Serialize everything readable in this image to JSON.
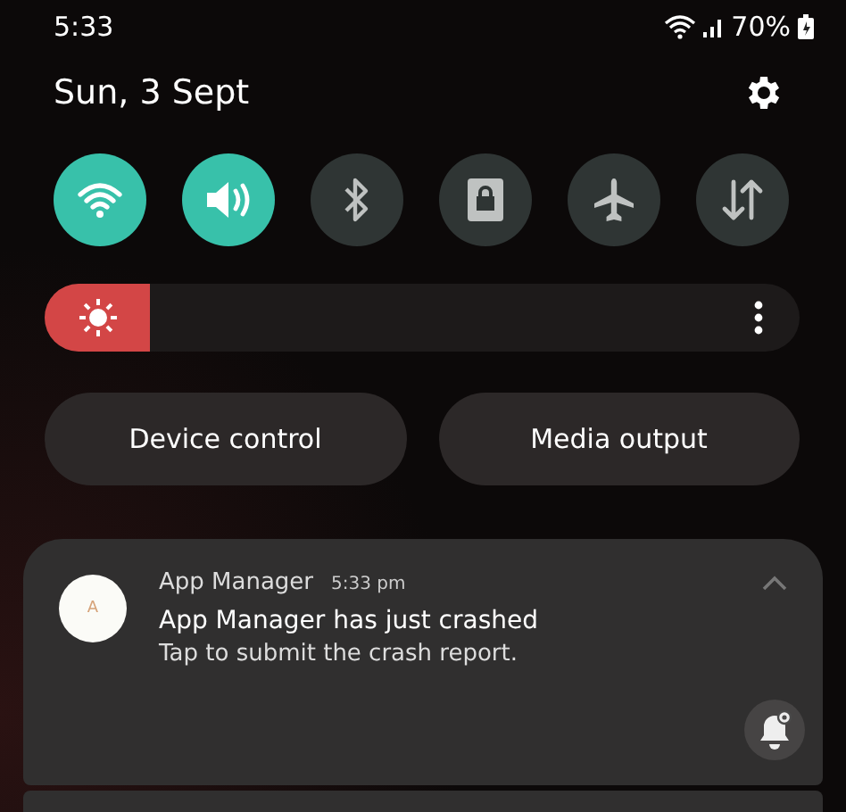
{
  "status_bar": {
    "time": "5:33",
    "battery": "70%"
  },
  "header": {
    "date": "Sun, 3 Sept"
  },
  "quick_tiles": [
    {
      "kind": "wifi",
      "on": true
    },
    {
      "kind": "sound",
      "on": true
    },
    {
      "kind": "bluetooth",
      "on": false
    },
    {
      "kind": "lock",
      "on": false
    },
    {
      "kind": "airplane",
      "on": false
    },
    {
      "kind": "data",
      "on": false
    }
  ],
  "brightness": {
    "level": 0.14
  },
  "buttons": [
    "Device control",
    "Media output"
  ],
  "notification": {
    "app_icon_letter": "A",
    "app": "App Manager",
    "time": "5:33 pm",
    "title": "App Manager has just crashed",
    "text": "Tap to submit the crash report.",
    "expanded": true
  }
}
